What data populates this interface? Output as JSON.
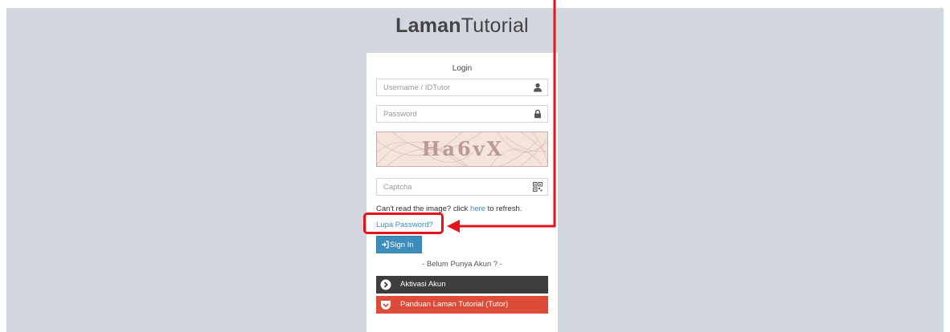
{
  "brand": {
    "bold": "Laman",
    "rest": "Tutorial"
  },
  "login": {
    "title": "Login",
    "username_placeholder": "Username / IDTutor",
    "password_placeholder": "Password",
    "captcha_text": "Ha6vX",
    "captcha_placeholder": "Captcha",
    "hint_prefix": "Can't read the image? click ",
    "hint_link": "here",
    "hint_suffix": " to refresh.",
    "forgot_label": "Lupa Password?",
    "signin_label": "Sign In",
    "no_account": "- Belum Punya Akun ? -",
    "aktivasi_label": "Aktivasi Akun",
    "panduan_label": "Panduan Laman Tutorial (Tutor)"
  },
  "colors": {
    "page_bg": "#d2d6de",
    "primary": "#3c8dbc",
    "dark_button": "#3d3d3d",
    "red_button": "#dd4b39",
    "annotation": "#e4141b"
  },
  "icons": {
    "username": "user-icon",
    "password": "lock-icon",
    "captcha": "qrcode-icon",
    "signin": "sign-in-icon",
    "aktivasi": "chevron-circle-right-icon",
    "panduan": "pocket-icon"
  }
}
